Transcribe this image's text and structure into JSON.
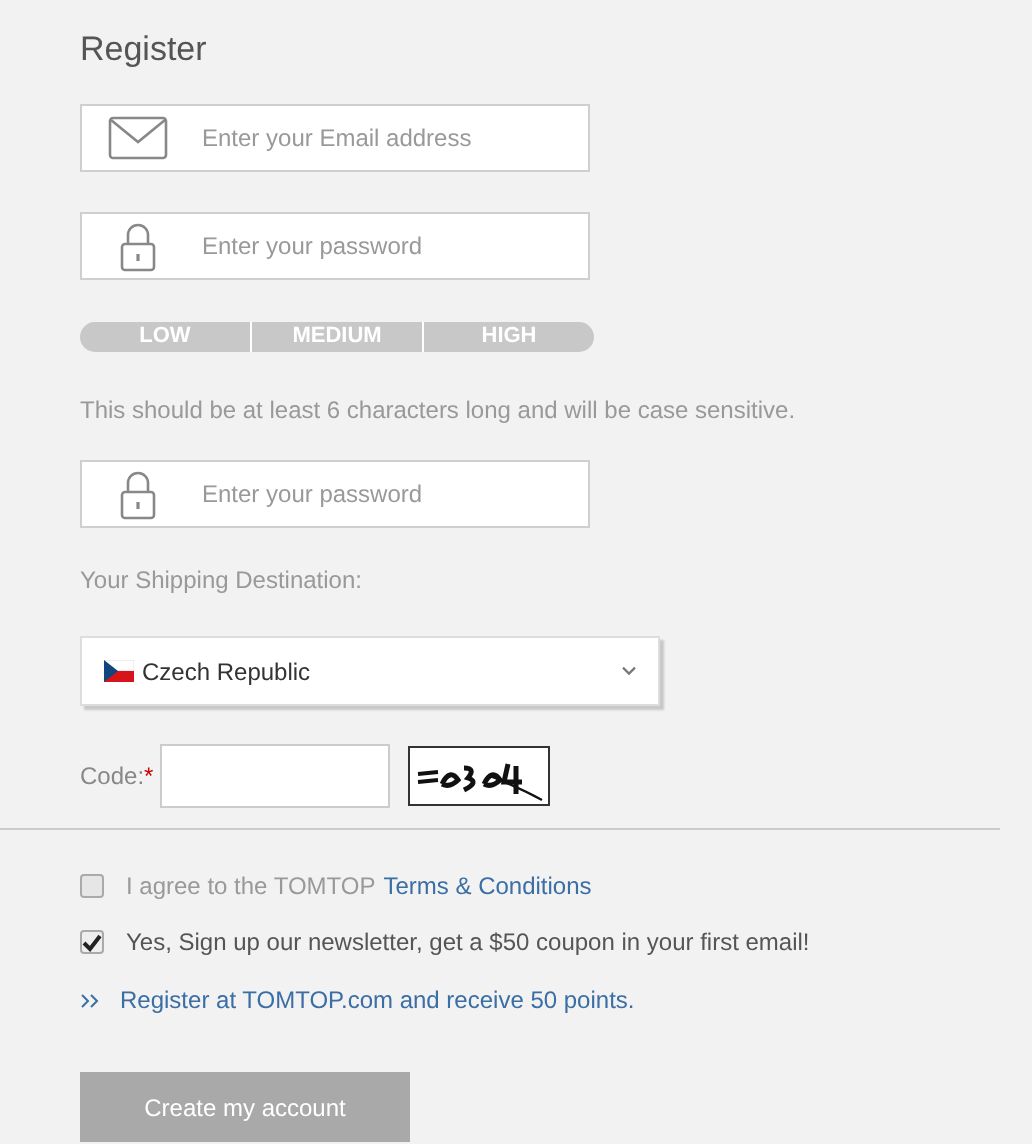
{
  "title": "Register",
  "fields": [
    {
      "kind": "email",
      "placeholder": "Enter your Email address"
    },
    {
      "kind": "password",
      "placeholder": "Enter your password"
    }
  ],
  "strength": [
    "LOW",
    "MEDIUM",
    "HIGH"
  ],
  "hint": "This should be at least 6 characters long and will be case sensitive.",
  "confirm": {
    "kind": "password",
    "placeholder": "Enter your password"
  },
  "shipping": {
    "label": "Your Shipping Destination:",
    "value": "Czech Republic"
  },
  "code": {
    "label": "Code:",
    "required_mark": "*"
  },
  "agreements": [
    {
      "text": "I agree to the TOMTOP ",
      "link": "Terms & Conditions",
      "checked": false
    },
    {
      "text": "Yes, Sign up our newsletter, get a $50 coupon in your first email!",
      "checked": true
    }
  ],
  "points_link": "Register at TOMTOP.com and receive 50 points.",
  "submit": {
    "label": "Create my account",
    "disabled": true
  }
}
